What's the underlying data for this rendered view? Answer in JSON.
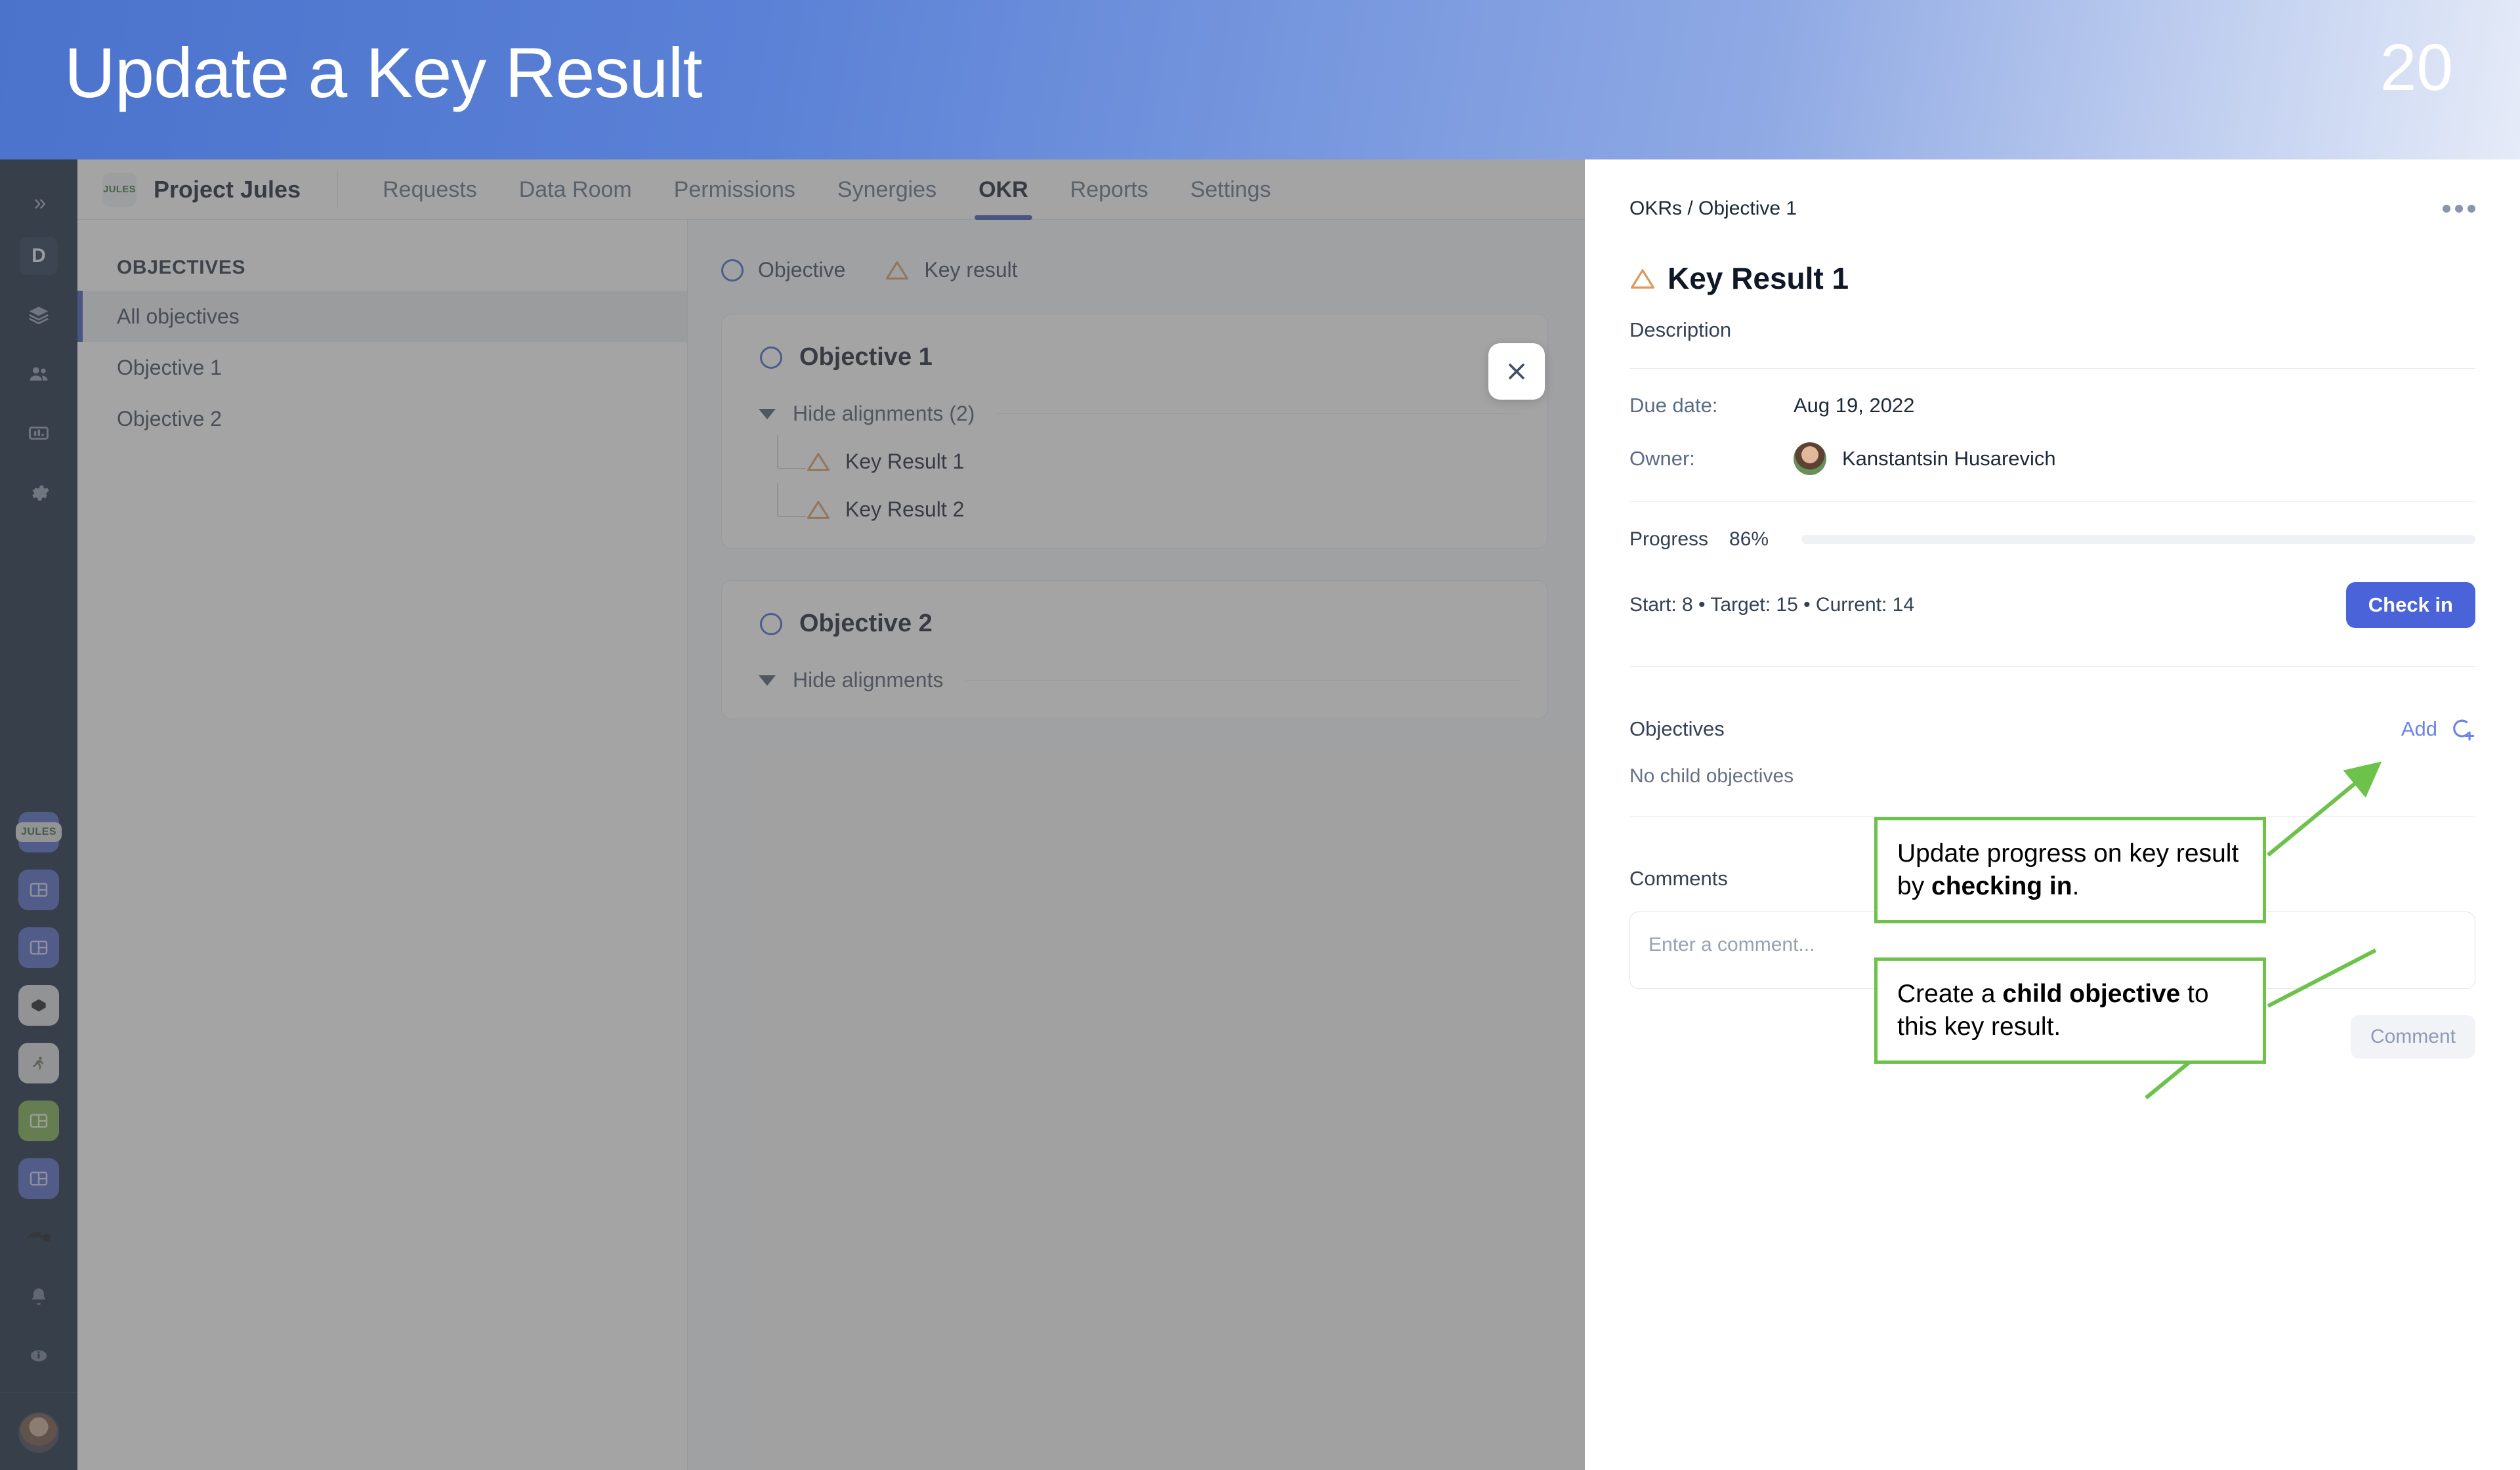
{
  "banner": {
    "title": "Update a Key Result",
    "number": "20"
  },
  "rail": {
    "expand_label": "»",
    "items": [
      {
        "name": "workspace-d",
        "label": "D"
      },
      {
        "name": "layers",
        "label": ""
      },
      {
        "name": "people",
        "label": ""
      },
      {
        "name": "reports",
        "label": ""
      },
      {
        "name": "settings",
        "label": ""
      }
    ],
    "project_tiles": [
      {
        "name": "jules",
        "label": "JULES"
      },
      {
        "name": "project-blue-1",
        "label": ""
      },
      {
        "name": "project-blue-2",
        "label": ""
      },
      {
        "name": "project-blue-3",
        "label": ""
      },
      {
        "name": "project-dark",
        "label": ""
      },
      {
        "name": "project-runner",
        "label": ""
      },
      {
        "name": "project-green",
        "label": ""
      },
      {
        "name": "project-blue-4",
        "label": ""
      },
      {
        "name": "project-logo",
        "label": ""
      }
    ]
  },
  "project_header": {
    "logo_label": "JULES",
    "name": "Project Jules",
    "tabs": [
      {
        "label": "Requests",
        "active": false
      },
      {
        "label": "Data Room",
        "active": false
      },
      {
        "label": "Permissions",
        "active": false
      },
      {
        "label": "Synergies",
        "active": false
      },
      {
        "label": "OKR",
        "active": true
      },
      {
        "label": "Reports",
        "active": false
      },
      {
        "label": "Settings",
        "active": false
      }
    ]
  },
  "objectives_sidebar": {
    "title": "OBJECTIVES",
    "items": [
      {
        "label": "All objectives",
        "selected": true
      },
      {
        "label": "Objective 1",
        "selected": false
      },
      {
        "label": "Objective 2",
        "selected": false
      }
    ]
  },
  "okr_main": {
    "legend": [
      {
        "label": "Objective",
        "icon": "circle-icon"
      },
      {
        "label": "Key result",
        "icon": "triangle-icon"
      }
    ],
    "cards": [
      {
        "title": "Objective 1",
        "alignments_label": "Hide alignments (2)",
        "key_results": [
          "Key Result 1",
          "Key Result 2"
        ]
      },
      {
        "title": "Objective 2",
        "alignments_label": "Hide alignments",
        "key_results": []
      }
    ]
  },
  "close_button": {
    "label": "×"
  },
  "panel": {
    "breadcrumb": "OKRs / Objective 1",
    "more_menu": "•••",
    "title": "Key Result 1",
    "description": "Description",
    "due_date_label": "Due date:",
    "due_date_value": "Aug 19, 2022",
    "owner_label": "Owner:",
    "owner_value": "Kanstantsin Husarevich",
    "progress_label": "Progress",
    "progress_pct": "86%",
    "progress_value": 86,
    "stats": "Start: 8  •  Target: 15  •  Current: 14",
    "checkin_label": "Check in",
    "objectives_label": "Objectives",
    "add_label": "Add",
    "no_child_objectives": "No child objectives",
    "comments_label": "Comments",
    "comment_placeholder": "Enter a comment...",
    "comment_button_label": "Comment"
  },
  "annotations": [
    {
      "name": "annotation-check-in",
      "text_before": "Update progress on key result by ",
      "text_bold": "checking in",
      "text_after": "."
    },
    {
      "name": "annotation-child-objective",
      "text_before": "Create a ",
      "text_bold": "child objective",
      "text_after": " to this key result."
    }
  ],
  "colors": {
    "accent_blue": "#4a63d8",
    "progress_green": "#63c068",
    "annotation_green": "#6cc24a",
    "key_result_orange": "#d99a63",
    "objective_blue": "#3b63c4"
  }
}
